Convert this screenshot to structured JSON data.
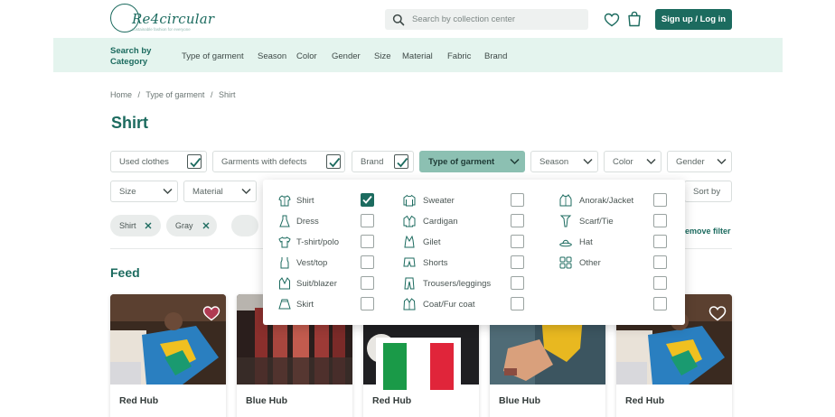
{
  "header": {
    "logo_text": "Re4circular",
    "logo_tagline": "sustainable fashion for everyone",
    "search_placeholder": "Search by collection center",
    "signup_label": "Sign up / Log in"
  },
  "category_bar": {
    "title": "Search by Category",
    "items": [
      "Type of garment",
      "Season",
      "Color",
      "Gender",
      "Size",
      "Material",
      "Fabric",
      "Brand"
    ]
  },
  "breadcrumb": [
    "Home",
    "/",
    "Type of garment",
    "/",
    "Shirt"
  ],
  "page_title": "Shirt",
  "filters": {
    "row1": [
      {
        "label": "Used clothes",
        "kind": "check",
        "checked": true
      },
      {
        "label": "Garments with defects",
        "kind": "check",
        "checked": true
      },
      {
        "label": "Brand",
        "kind": "check",
        "checked": true
      },
      {
        "label": "Type of garment",
        "kind": "dropdown",
        "active": true
      },
      {
        "label": "Season",
        "kind": "dropdown"
      },
      {
        "label": "Color",
        "kind": "dropdown"
      },
      {
        "label": "Gender",
        "kind": "dropdown"
      }
    ],
    "row2": [
      {
        "label": "Size",
        "kind": "dropdown"
      },
      {
        "label": "Material",
        "kind": "dropdown"
      }
    ],
    "sort_label": "Sort by"
  },
  "chips": [
    {
      "label": "Shirt"
    },
    {
      "label": "Gray"
    }
  ],
  "remove_filter_label": "emove filter",
  "feed_title": "Feed",
  "cards": [
    {
      "name": "Red Hub",
      "favorited": true
    },
    {
      "name": "Blue Hub",
      "favorited": false
    },
    {
      "name": "Red Hub",
      "favorited": false
    },
    {
      "name": "Blue Hub",
      "favorited": false
    },
    {
      "name": "Red Hub",
      "favorited": false
    }
  ],
  "dropdown": {
    "columns": [
      [
        {
          "label": "Shirt",
          "icon": "shirt-icon",
          "checked": true
        },
        {
          "label": "Dress",
          "icon": "dress-icon",
          "checked": false
        },
        {
          "label": "T-shirt/polo",
          "icon": "tshirt-icon",
          "checked": false
        },
        {
          "label": "Vest/top",
          "icon": "vest-icon",
          "checked": false
        },
        {
          "label": "Suit/blazer",
          "icon": "blazer-icon",
          "checked": false
        },
        {
          "label": "Skirt",
          "icon": "skirt-icon",
          "checked": false
        }
      ],
      [
        {
          "label": "Sweater",
          "icon": "sweater-icon",
          "checked": false
        },
        {
          "label": "Cardigan",
          "icon": "cardigan-icon",
          "checked": false
        },
        {
          "label": "Gilet",
          "icon": "gilet-icon",
          "checked": false
        },
        {
          "label": "Shorts",
          "icon": "shorts-icon",
          "checked": false
        },
        {
          "label": "Trousers/leggings",
          "icon": "trousers-icon",
          "checked": false
        },
        {
          "label": "Coat/Fur coat",
          "icon": "coat-icon",
          "checked": false
        }
      ],
      [
        {
          "label": "Anorak/Jacket",
          "icon": "jacket-icon",
          "checked": false
        },
        {
          "label": "Scarf/Tie",
          "icon": "tie-icon",
          "checked": false
        },
        {
          "label": "Hat",
          "icon": "hat-icon",
          "checked": false
        },
        {
          "label": "Other",
          "icon": "other-icon",
          "checked": false
        },
        {
          "label": "",
          "icon": "",
          "checked": false
        },
        {
          "label": "",
          "icon": "",
          "checked": false
        }
      ]
    ]
  },
  "colors": {
    "brand": "#1c6b5f",
    "category_bar_bg": "#e4f4ee",
    "active_filter": "#8cc0b2",
    "favorite_heart": "#b03a52"
  }
}
